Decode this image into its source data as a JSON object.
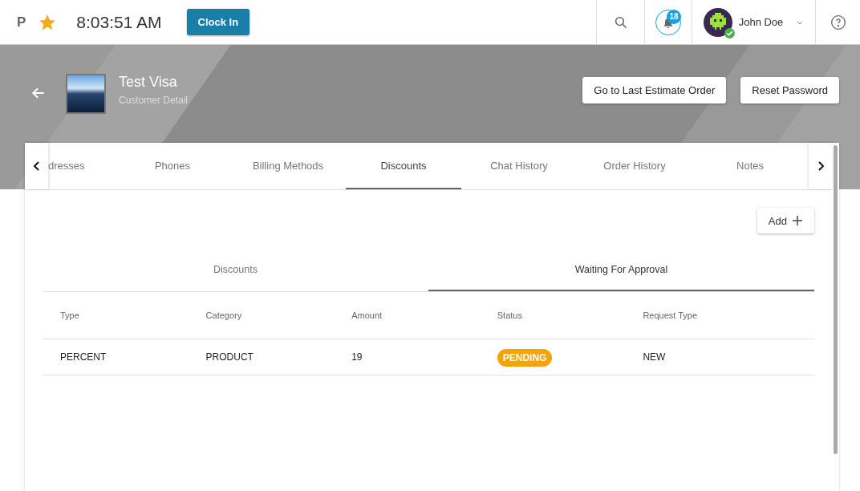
{
  "topbar": {
    "logo": "P",
    "favorite": true,
    "time": "8:03:51 AM",
    "clock_button": "Clock In",
    "notifications": "18",
    "user": {
      "name": "John Doe",
      "online": true
    }
  },
  "header": {
    "title": "Test Visa",
    "subtitle": "Customer Detail",
    "buttons": [
      "Go to Last Estimate Order",
      "Reset Password"
    ]
  },
  "tabs": [
    {
      "label": "dresses",
      "selected": false
    },
    {
      "label": "Phones",
      "selected": false
    },
    {
      "label": "Billing Methods",
      "selected": false
    },
    {
      "label": "Discounts",
      "selected": true
    },
    {
      "label": "Chat History",
      "selected": false
    },
    {
      "label": "Order History",
      "selected": false
    },
    {
      "label": "Notes",
      "selected": false
    }
  ],
  "add_button": "Add",
  "subtabs": [
    {
      "label": "Discounts",
      "selected": false
    },
    {
      "label": "Waiting For Approval",
      "selected": true
    }
  ],
  "table": {
    "columns": [
      "Type",
      "Category",
      "Amount",
      "Status",
      "Request Type"
    ],
    "rows": [
      {
        "type": "PERCENT",
        "category": "PRODUCT",
        "amount": "19",
        "status": "PENDING",
        "request_type": "NEW"
      }
    ]
  }
}
